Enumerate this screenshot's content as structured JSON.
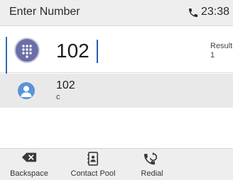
{
  "status_bar": {
    "title": "Enter Number",
    "time": "23:38",
    "call_icon": "phone-icon"
  },
  "input": {
    "value": "102",
    "dialpad_icon": "dialpad-icon",
    "result_label": "Result",
    "result_count": "1"
  },
  "results": [
    {
      "number": "102",
      "name": "c",
      "icon": "contact-avatar-icon"
    }
  ],
  "softkeys": [
    {
      "label": "Backspace",
      "icon": "backspace-icon"
    },
    {
      "label": "Contact Pool",
      "icon": "contact-book-icon"
    },
    {
      "label": "Redial",
      "icon": "redial-icon"
    }
  ],
  "colors": {
    "accent": "#2f6db5",
    "avatar": "#5b93d8",
    "dialpad_button": "#6b6fa5",
    "status_bar_bg": "#eeeeee",
    "selected_row_bg": "#e9e9e9"
  }
}
